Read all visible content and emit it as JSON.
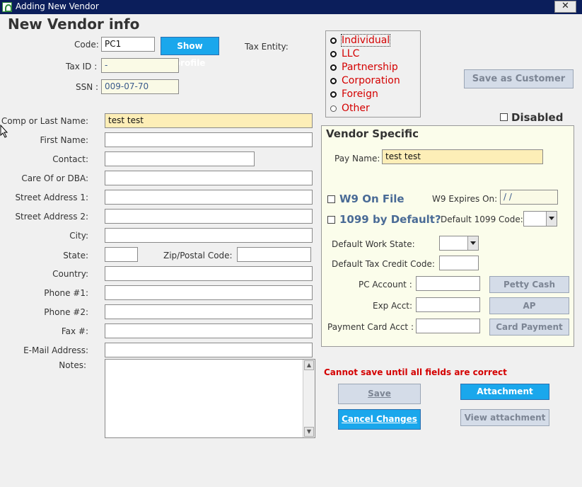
{
  "window": {
    "title": "Adding New Vendor",
    "close_glyph": "✕"
  },
  "page_title": "New Vendor info",
  "header": {
    "code_label": "Code:",
    "code_value": "PC1",
    "show_profile": "Show profile",
    "tax_id_label": "Tax ID :",
    "tax_id_value": "  -",
    "ssn_label": "SSN :",
    "ssn_value": "009-07-70",
    "tax_entity_label": "Tax Entity:"
  },
  "tax_entity": {
    "options": [
      "Individual",
      "LLC",
      "Partnership",
      "Corporation",
      "Foreign",
      "Other"
    ],
    "selected": "Individual"
  },
  "save_as_customer": "Save as Customer",
  "disabled_label": "Disabled",
  "form": {
    "comp_label": "Comp or Last Name:",
    "comp_value": "test test",
    "first_label": "First Name:",
    "first_value": "",
    "contact_label": "Contact:",
    "contact_value": "",
    "careof_label": "Care Of or DBA:",
    "careof_value": "",
    "street1_label": "Street Address 1:",
    "street1_value": "",
    "street2_label": "Street Address 2:",
    "street2_value": "",
    "city_label": "City:",
    "city_value": "",
    "state_label": "State:",
    "state_value": "",
    "zip_label": "Zip/Postal Code:",
    "zip_value": "",
    "country_label": "Country:",
    "country_value": "",
    "phone1_label": "Phone #1:",
    "phone1_value": "",
    "phone2_label": "Phone #2:",
    "phone2_value": "",
    "fax_label": "Fax #:",
    "fax_value": "",
    "email_label": "E-Mail Address:",
    "email_value": "",
    "notes_label": "Notes:",
    "notes_value": ""
  },
  "vendor": {
    "title": "Vendor Specific",
    "pay_name_label": "Pay Name:",
    "pay_name_value": "test test",
    "w9_label": "W9 On File",
    "w9_expires_label": "W9 Expires On:",
    "w9_expires_value": "  /  /",
    "default1099_label": "1099 by Default?",
    "default1099_code_label": "Default 1099 Code:",
    "work_state_label": "Default Work State:",
    "tax_credit_label": "Default Tax Credit Code:",
    "pc_account_label": "PC Account :",
    "exp_acct_label": "Exp Acct:",
    "payment_card_label": "Payment Card Acct :",
    "petty_cash": "Petty Cash",
    "ap": "AP",
    "card_payment": "Card Payment"
  },
  "error_message": "Cannot save until all fields are correct",
  "buttons": {
    "save": "Save",
    "cancel": "Cancel Changes",
    "attachment": "Attachment",
    "view_attachment": "View attachment"
  },
  "colors": {
    "title_bar": "#0b1e5b",
    "accent_blue": "#1aa7ec",
    "error_red": "#d40000",
    "panel": "#fbfdeb"
  }
}
